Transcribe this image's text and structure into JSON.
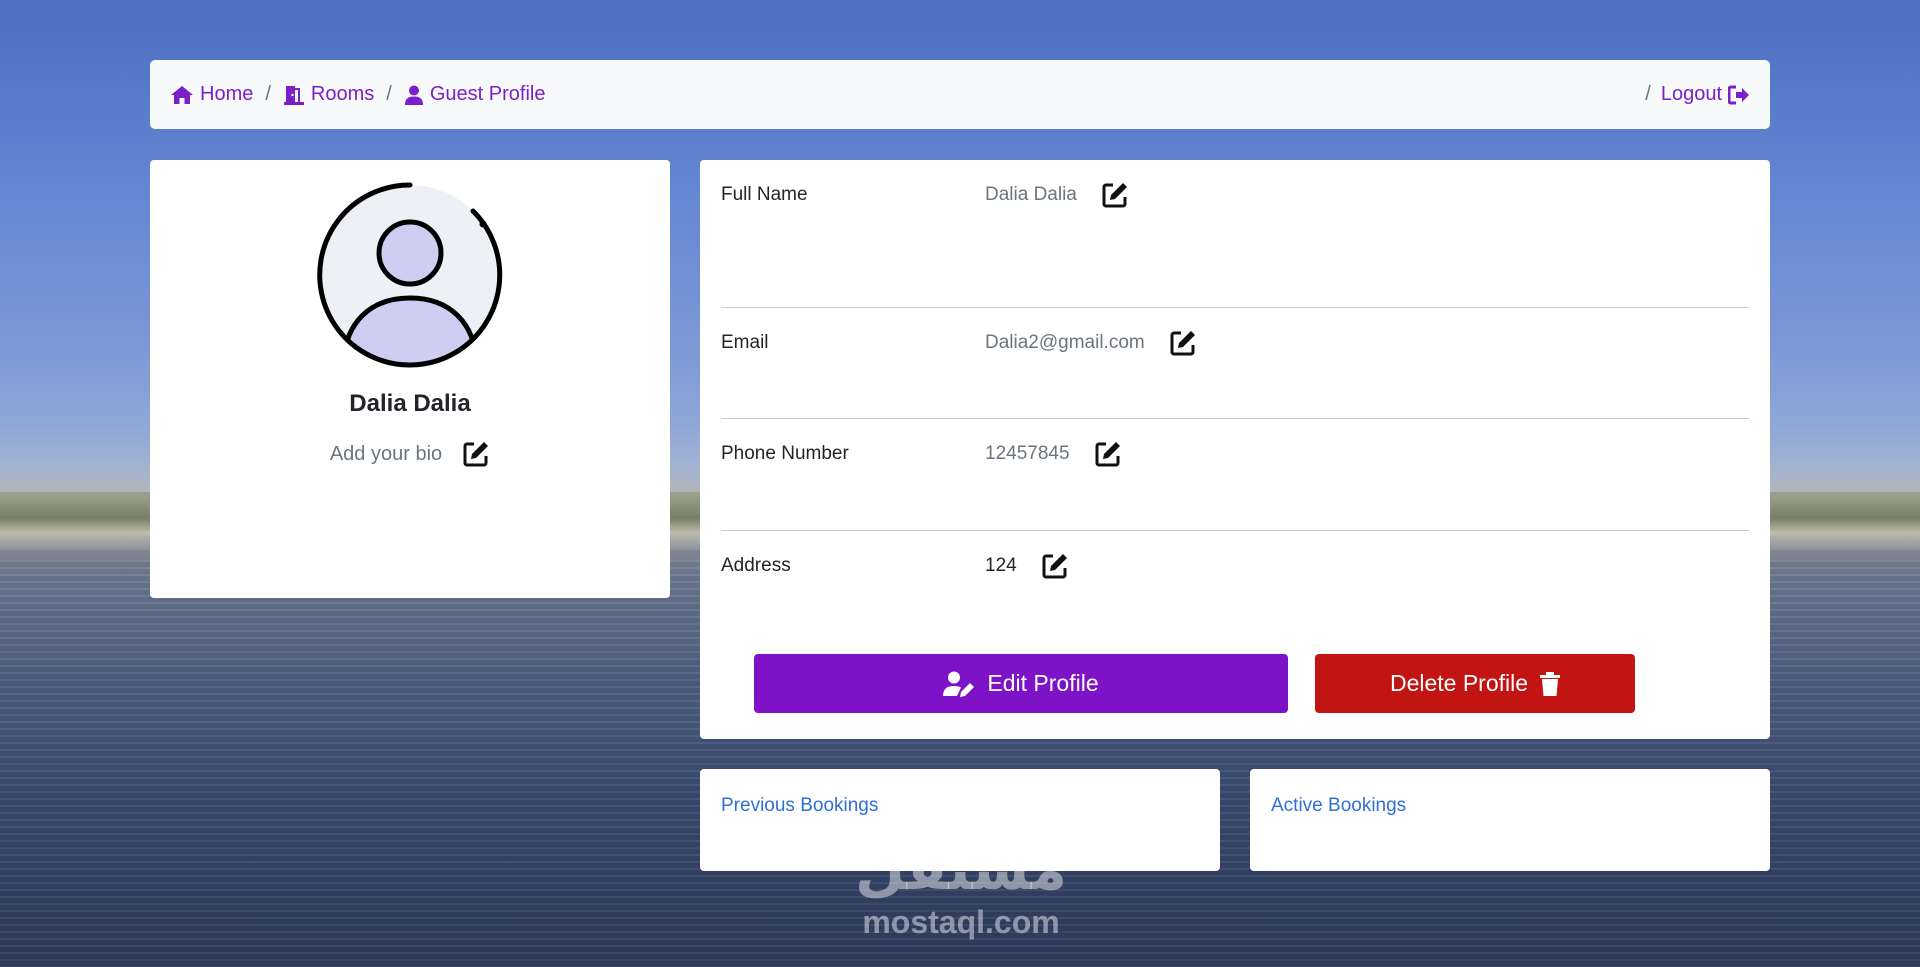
{
  "breadcrumb": {
    "home": "Home",
    "rooms": "Rooms",
    "guest_profile": "Guest Profile",
    "separator": "/"
  },
  "nav": {
    "logout": "Logout"
  },
  "profile": {
    "name": "Dalia Dalia",
    "bio_placeholder": "Add your bio"
  },
  "details": [
    {
      "label": "Full Name",
      "value": "Dalia Dalia"
    },
    {
      "label": "Email",
      "value": "Dalia2@gmail.com"
    },
    {
      "label": "Phone Number",
      "value": "12457845"
    },
    {
      "label": "Address",
      "value": "124"
    }
  ],
  "buttons": {
    "edit": "Edit Profile",
    "delete": "Delete Profile"
  },
  "bookings": {
    "previous": "Previous Bookings",
    "active": "Active Bookings"
  },
  "watermark": {
    "arabic": "مستقل",
    "latin": "mostaql.com"
  },
  "colors": {
    "accent": "#7e12c6",
    "danger": "#c31414",
    "link": "#2f6fd6"
  }
}
